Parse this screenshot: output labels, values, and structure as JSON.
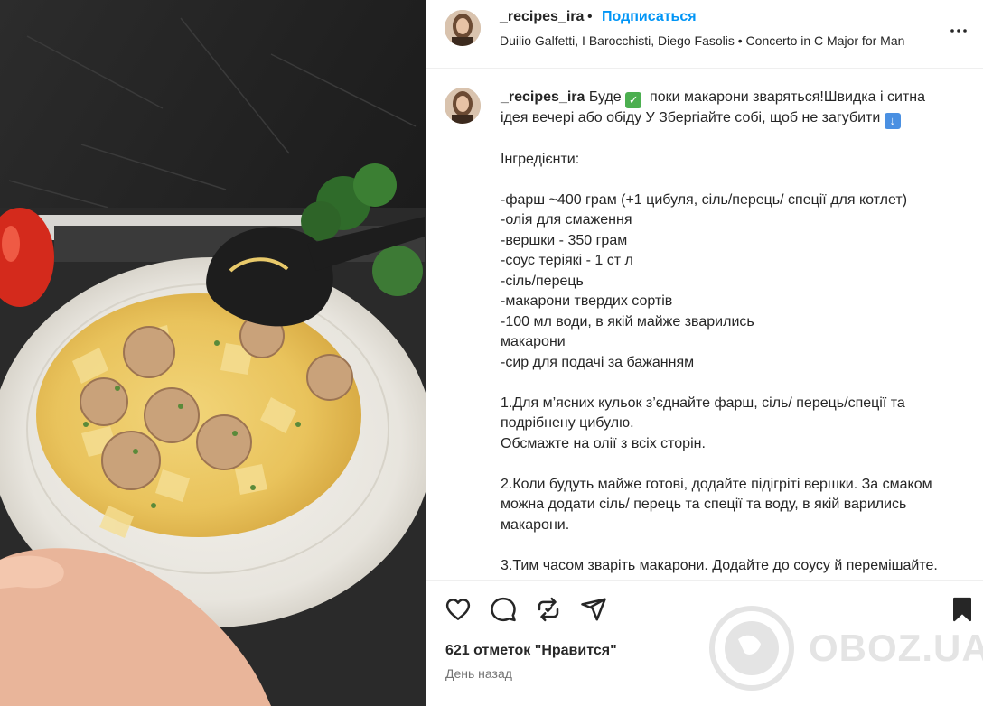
{
  "post": {
    "username": "_recipes_ira",
    "separator": "•",
    "follow_label": "Подписаться",
    "music": "Duilio Galfetti, I Barocchisti, Diego Fasolis • Concerto in C Major for Man",
    "more_icon": "more-horizontal-icon"
  },
  "caption": {
    "username": "_recipes_ira",
    "text_1": " Буде ",
    "text_2": "  поки макарони зваряться!Швидка і ситна ідея вечері або обіду У Збергіайте собі, щоб не загубити ",
    "body": "\n\nІнгредієнти:\n\n-фарш ~400 грам (+1 цибуля, сіль/перець/ спеції для котлет)\n-олія для смаження\n-вершки - 350 грам\n-соус теріякі - 1 ст л\n-сіль/перець\n-макарони твердих сортів\n-100 мл води, в якій майже зварились\nмакарони\n-сир для подачі за бажанням\n\n1.Для м’ясних кульок з’єднайте фарш, сіль/ перець/спеції та подрібнену цибулю.\nОбсмажте на олії з всіх сторін.\n\n2.Коли будуть майже готові, додайте підігріті вершки. За смаком можна додати сіль/ перець та спеції та воду, в якій варились\nмакарони.\n\n3.Тим часом зваріть макарони. Додайте до соусу й перемішайте."
  },
  "actions": {
    "like_icon": "heart-icon",
    "comment_icon": "comment-icon",
    "share_icon": "repost-icon",
    "send_icon": "send-icon",
    "save_icon": "bookmark-icon"
  },
  "likes_text": "621 отметок \"Нравится\"",
  "time_text": "День назад",
  "watermark": "OBOZ.UA",
  "colors": {
    "follow": "#0095f6",
    "text": "#262626",
    "muted": "#737373",
    "border": "#efefef"
  }
}
